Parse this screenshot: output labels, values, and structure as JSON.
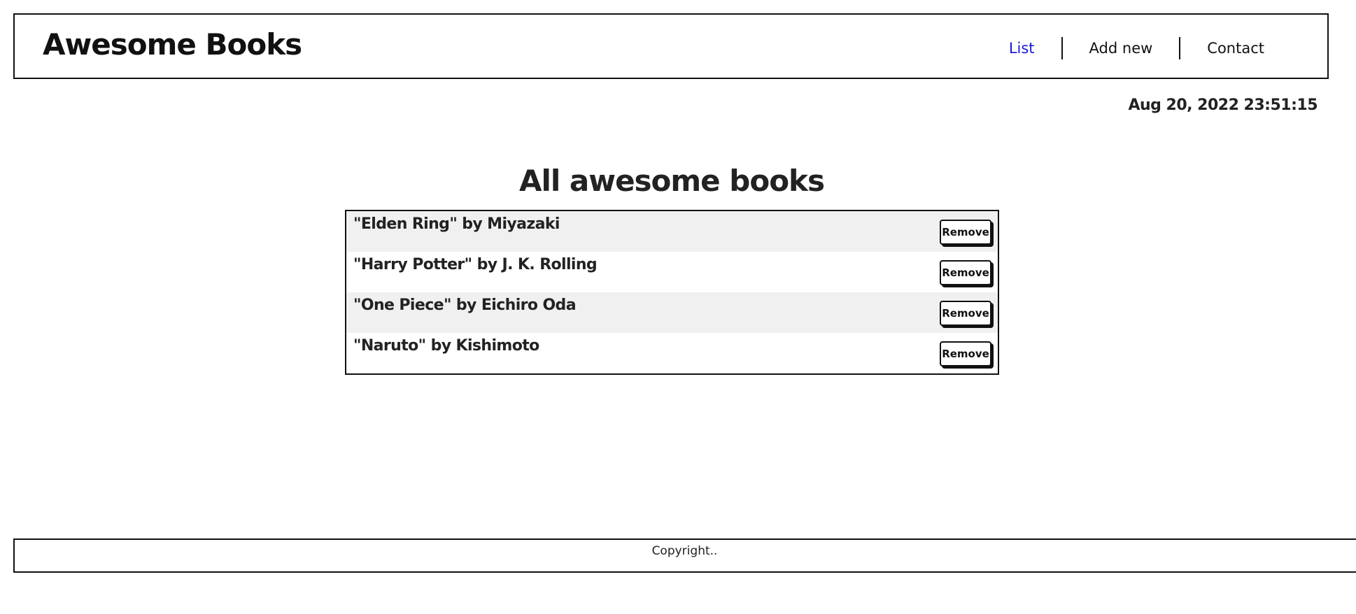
{
  "header": {
    "logo": "Awesome Books",
    "nav": [
      {
        "label": "List",
        "active": true
      },
      {
        "label": "Add new",
        "active": false
      },
      {
        "label": "Contact",
        "active": false
      }
    ]
  },
  "datetime": "Aug 20, 2022 23:51:15",
  "main": {
    "title": "All awesome books",
    "books": [
      {
        "text": "\"Elden Ring\" by Miyazaki",
        "button": "Remove"
      },
      {
        "text": "\"Harry Potter\" by J. K. Rolling",
        "button": "Remove"
      },
      {
        "text": "\"One Piece\" by Eichiro Oda",
        "button": "Remove"
      },
      {
        "text": "\"Naruto\" by Kishimoto",
        "button": "Remove"
      }
    ]
  },
  "footer": {
    "text": "Copyright.."
  },
  "colors": {
    "nav_active": "#1a1ad9",
    "row_alt": "#f0f0f0",
    "border": "#111111"
  }
}
